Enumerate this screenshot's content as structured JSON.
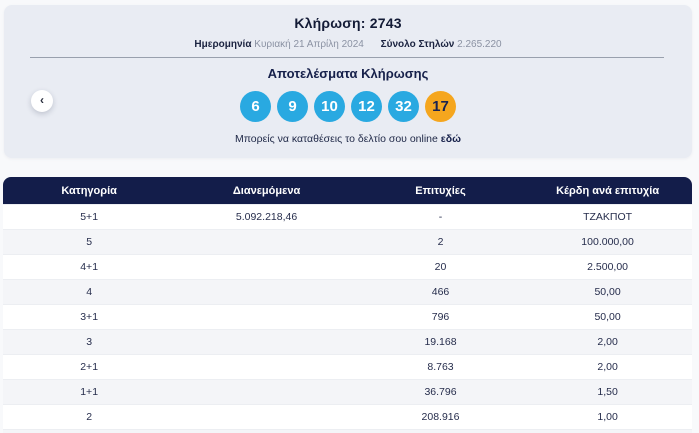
{
  "hero": {
    "draw_label": "Κλήρωση:",
    "draw_number": "2743",
    "date_label": "Ημερομηνία",
    "date_value": "Κυριακή 21 Απρίλη 2024",
    "columns_label": "Σύνολο Στηλών",
    "columns_value": "2.265.220",
    "results_title": "Αποτελέσματα Κλήρωσης",
    "numbers": [
      {
        "value": "6",
        "type": "main"
      },
      {
        "value": "9",
        "type": "main"
      },
      {
        "value": "10",
        "type": "main"
      },
      {
        "value": "12",
        "type": "main"
      },
      {
        "value": "32",
        "type": "main"
      },
      {
        "value": "17",
        "type": "joker"
      }
    ],
    "deposit_text": "Μπορείς να καταθέσεις το δελτίο σου online",
    "deposit_link": "εδώ",
    "prev_arrow": "‹"
  },
  "table": {
    "headers": [
      "Κατηγορία",
      "Διανεμόμενα",
      "Επιτυχίες",
      "Κέρδη ανά επιτυχία"
    ],
    "rows": [
      [
        "5+1",
        "5.092.218,46",
        "-",
        "ΤΖΑΚΠΟΤ"
      ],
      [
        "5",
        "",
        "2",
        "100.000,00"
      ],
      [
        "4+1",
        "",
        "20",
        "2.500,00"
      ],
      [
        "4",
        "",
        "466",
        "50,00"
      ],
      [
        "3+1",
        "",
        "796",
        "50,00"
      ],
      [
        "3",
        "",
        "19.168",
        "2,00"
      ],
      [
        "2+1",
        "",
        "8.763",
        "2,00"
      ],
      [
        "1+1",
        "",
        "36.796",
        "1,50"
      ],
      [
        "2",
        "",
        "208.916",
        "1,00"
      ]
    ]
  },
  "colors": {
    "ball_main": "#29a9e1",
    "ball_joker": "#f5a61e",
    "header_navy": "#131d4a",
    "card_bg": "#e9ecf3",
    "page_bg": "#f8f9fb"
  }
}
